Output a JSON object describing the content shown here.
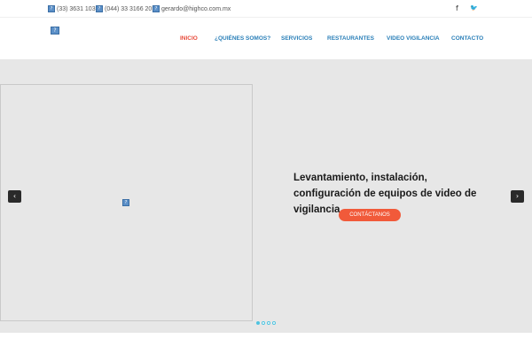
{
  "topbar": {
    "phone1": "(33) 3631 1039",
    "phone2": "(044) 33 3166 2052",
    "email": "gerardo@highco.com.mx",
    "icon_char": "?",
    "social": [
      {
        "icon": "facebook-icon",
        "glyph": "f"
      },
      {
        "icon": "twitter-icon",
        "glyph": "🐦"
      }
    ]
  },
  "header": {
    "logo_char": "?",
    "nav": [
      {
        "label": "INICIO",
        "active": true
      },
      {
        "label": "¿QUIÉNES SOMOS?",
        "active": false
      },
      {
        "label": "SERVICIOS",
        "active": false
      },
      {
        "label": "RESTAURANTES",
        "active": false
      },
      {
        "label": "VIDEO VIGILANCIA",
        "active": false
      },
      {
        "label": "CONTACTO",
        "active": false
      }
    ]
  },
  "hero": {
    "title": "Levantamiento, instalación, configuración de equipos de video de vigilancia.",
    "cta_label": "CONTÁCTANOS",
    "image_placeholder": "?",
    "prev": "‹",
    "next": "›",
    "dots": [
      true,
      false,
      false,
      false
    ]
  },
  "colors": {
    "accent_red": "#e74c3c",
    "nav_blue": "#2a7fb8",
    "cta_orange": "#f15a3a",
    "dot_cyan": "#4fc3e0",
    "hero_bg": "#e7e7e7"
  }
}
